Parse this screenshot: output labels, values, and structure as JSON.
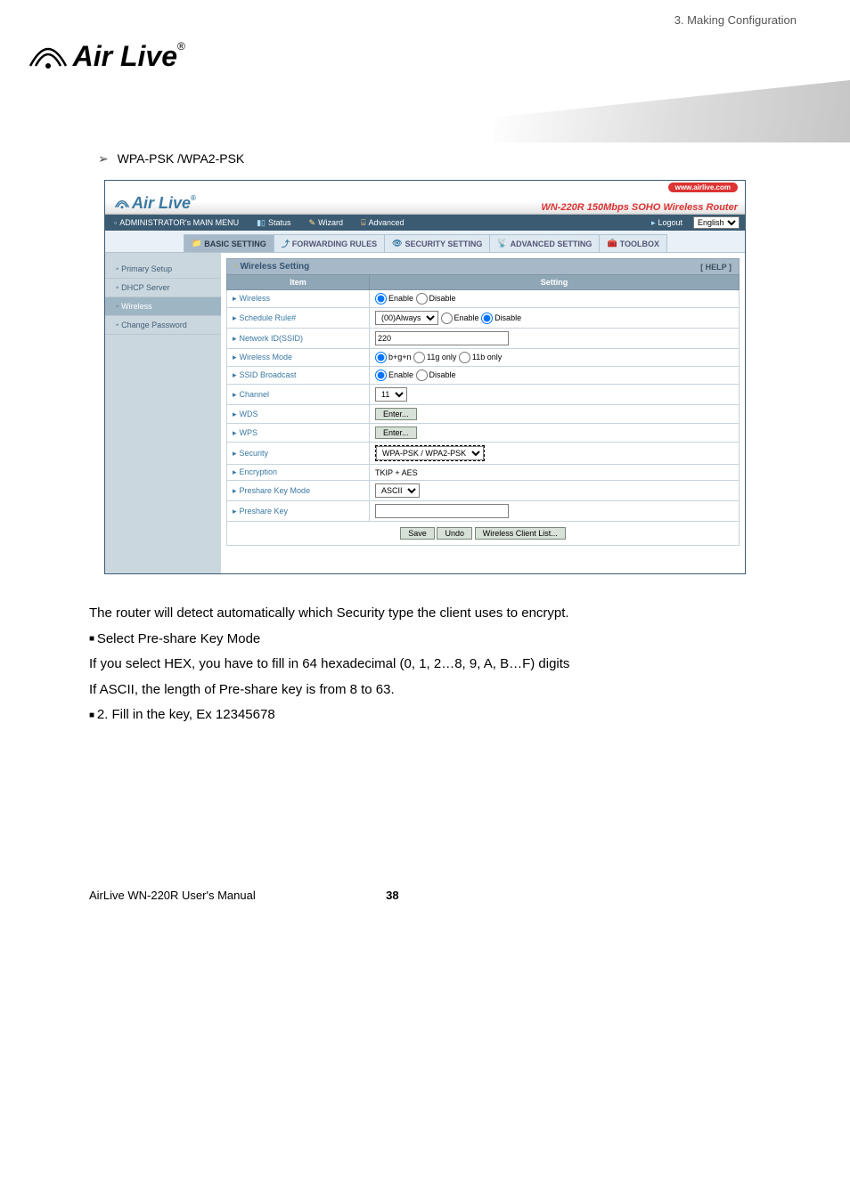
{
  "doc": {
    "context": "3.  Making  Configuration",
    "section_heading": "WPA-PSK /WPA2-PSK",
    "para1": "The router will detect automatically which Security type the client uses to encrypt.",
    "bullet1": "Select Pre-share Key Mode",
    "para2": "If you select HEX, you have to fill in 64 hexadecimal (0, 1, 2…8, 9, A, B…F) digits",
    "para3": "If ASCII, the length of Pre-share key is from 8 to 63.",
    "bullet2": "2. Fill in the key, Ex 12345678",
    "footer_left": "AirLive WN-220R User's Manual",
    "page_no": "38"
  },
  "router": {
    "brand": "Air Live",
    "site_badge": "www.airlive.com",
    "model": "WN-220R",
    "model_desc": "150Mbps SOHO Wireless Router",
    "menu_label": "ADMINISTRATOR's MAIN MENU",
    "menu_items": {
      "status": "Status",
      "wizard": "Wizard",
      "advanced": "Advanced",
      "logout": "Logout"
    },
    "lang": "English",
    "tabs": {
      "basic": "BASIC SETTING",
      "forwarding": "FORWARDING RULES",
      "security": "SECURITY SETTING",
      "advanced": "ADVANCED SETTING",
      "toolbox": "TOOLBOX"
    },
    "sidebar": {
      "primary": "Primary Setup",
      "dhcp": "DHCP Server",
      "wireless": "Wireless",
      "change_pw": "Change Password"
    },
    "panel": {
      "title": "Wireless Setting",
      "help": "[ HELP ]",
      "col_item": "Item",
      "col_setting": "Setting",
      "rows": {
        "wireless": "Wireless",
        "schedule": "Schedule Rule#",
        "ssid": "Network ID(SSID)",
        "mode": "Wireless Mode",
        "broadcast": "SSID Broadcast",
        "channel": "Channel",
        "wds": "WDS",
        "wps": "WPS",
        "security": "Security",
        "encryption": "Encryption",
        "pskmode": "Preshare Key Mode",
        "psk": "Preshare Key"
      },
      "values": {
        "enable": "Enable",
        "disable": "Disable",
        "schedule_opt": "(00)Always ",
        "ssid_val": "220",
        "mode_bgn": "b+g+n",
        "mode_g": "11g only",
        "mode_b": "11b only",
        "channel_val": "11",
        "enter": "Enter...",
        "sec_opt": "WPA-PSK / WPA2-PSK ",
        "enc_val": "TKIP + AES",
        "pskmode_opt": "ASCII"
      },
      "buttons": {
        "save": "Save",
        "undo": "Undo",
        "client_list": "Wireless Client List..."
      }
    }
  }
}
